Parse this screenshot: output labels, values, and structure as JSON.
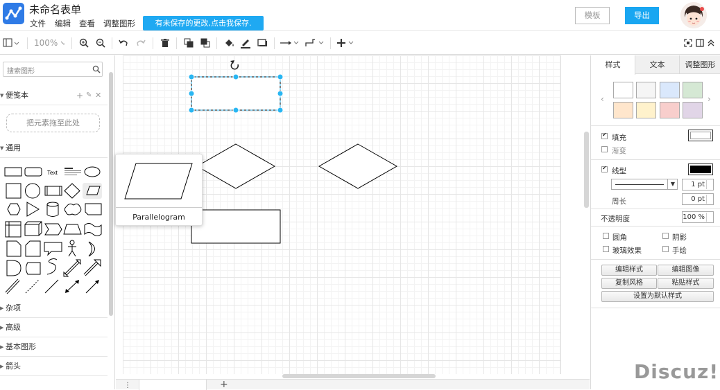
{
  "app": {
    "title": "未命名表单"
  },
  "menu": [
    "文件",
    "编辑",
    "查看",
    "调整图形"
  ],
  "unsaved_notice": "有未保存的更改,点击我保存.",
  "header_buttons": {
    "template": "模板",
    "export": "导出"
  },
  "toolbar": {
    "zoom": "100%"
  },
  "left_panel": {
    "search_placeholder": "搜索图形",
    "scratchpad": {
      "title": "便笺本",
      "dropzone": "把元素拖至此处"
    },
    "general": {
      "title": "通用"
    },
    "shape_text_label": "Text",
    "sections": [
      "杂项",
      "高级",
      "基本图形",
      "箭头"
    ]
  },
  "tooltip": {
    "shape_name": "Parallelogram"
  },
  "right_panel": {
    "tabs": [
      "样式",
      "文本",
      "调整图形"
    ],
    "swatch_colors": [
      "#ffffff",
      "#f5f5f5",
      "#dae8fc",
      "#d5e8d4",
      "#ffe6cc",
      "#fff2cc",
      "#f8cecc",
      "#e1d5e7"
    ],
    "fill": {
      "label": "填充",
      "checked": true,
      "color": "#ffffff"
    },
    "gradient": {
      "label": "渐变",
      "checked": false
    },
    "line": {
      "label": "线型",
      "checked": true,
      "color": "#000000",
      "width": "1 pt"
    },
    "perimeter": {
      "label": "周长",
      "value": "0 pt"
    },
    "opacity": {
      "label": "不透明度",
      "value": "100 %"
    },
    "options": [
      {
        "label": "圆角",
        "checked": false
      },
      {
        "label": "阴影",
        "checked": false
      },
      {
        "label": "玻璃效果",
        "checked": false
      },
      {
        "label": "手绘",
        "checked": false
      }
    ],
    "buttons": [
      "编辑样式",
      "编辑图像",
      "复制风格",
      "粘贴样式",
      "设置为默认样式"
    ]
  },
  "watermark": "Discuz!"
}
